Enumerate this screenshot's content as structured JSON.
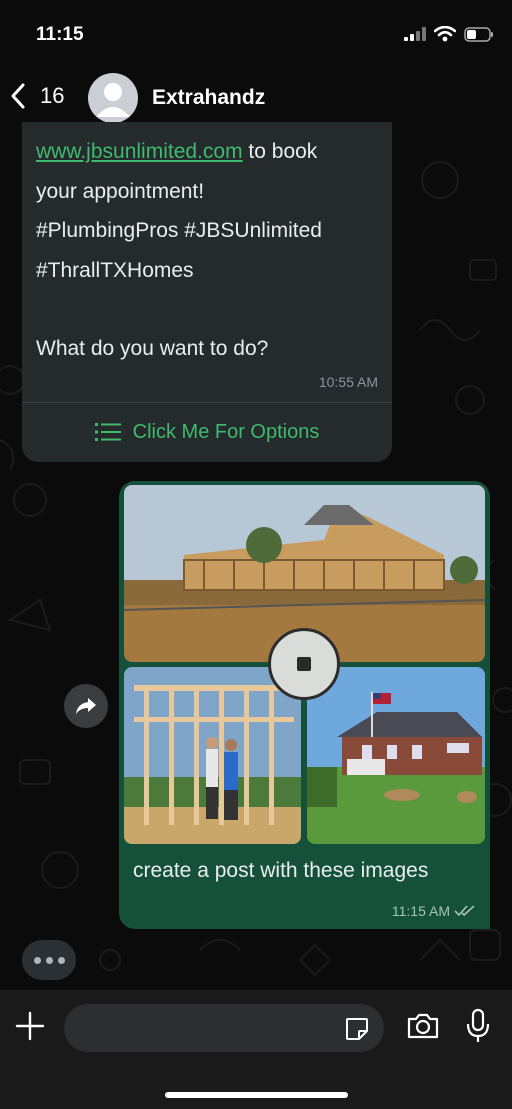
{
  "status_bar": {
    "time": "11:15"
  },
  "header": {
    "back_count": "16",
    "contact_name": "Extrahandz"
  },
  "incoming_message": {
    "link": "www.jbsunlimited.com",
    "line1_rest": " to book",
    "line2": "your appointment!",
    "line3": "#PlumbingPros #JBSUnlimited",
    "line4": "#ThrallTXHomes",
    "line5": "What do you want to do?",
    "time": "10:55 AM",
    "options_label": "Click Me For Options"
  },
  "outgoing_message": {
    "caption": "create a post with these images",
    "time": "11:15 AM",
    "read_status": "double-check-icon"
  },
  "colors": {
    "accent_green": "#3fba6e",
    "outgoing_bubble": "#15503a",
    "incoming_bubble": "#252a2d"
  }
}
